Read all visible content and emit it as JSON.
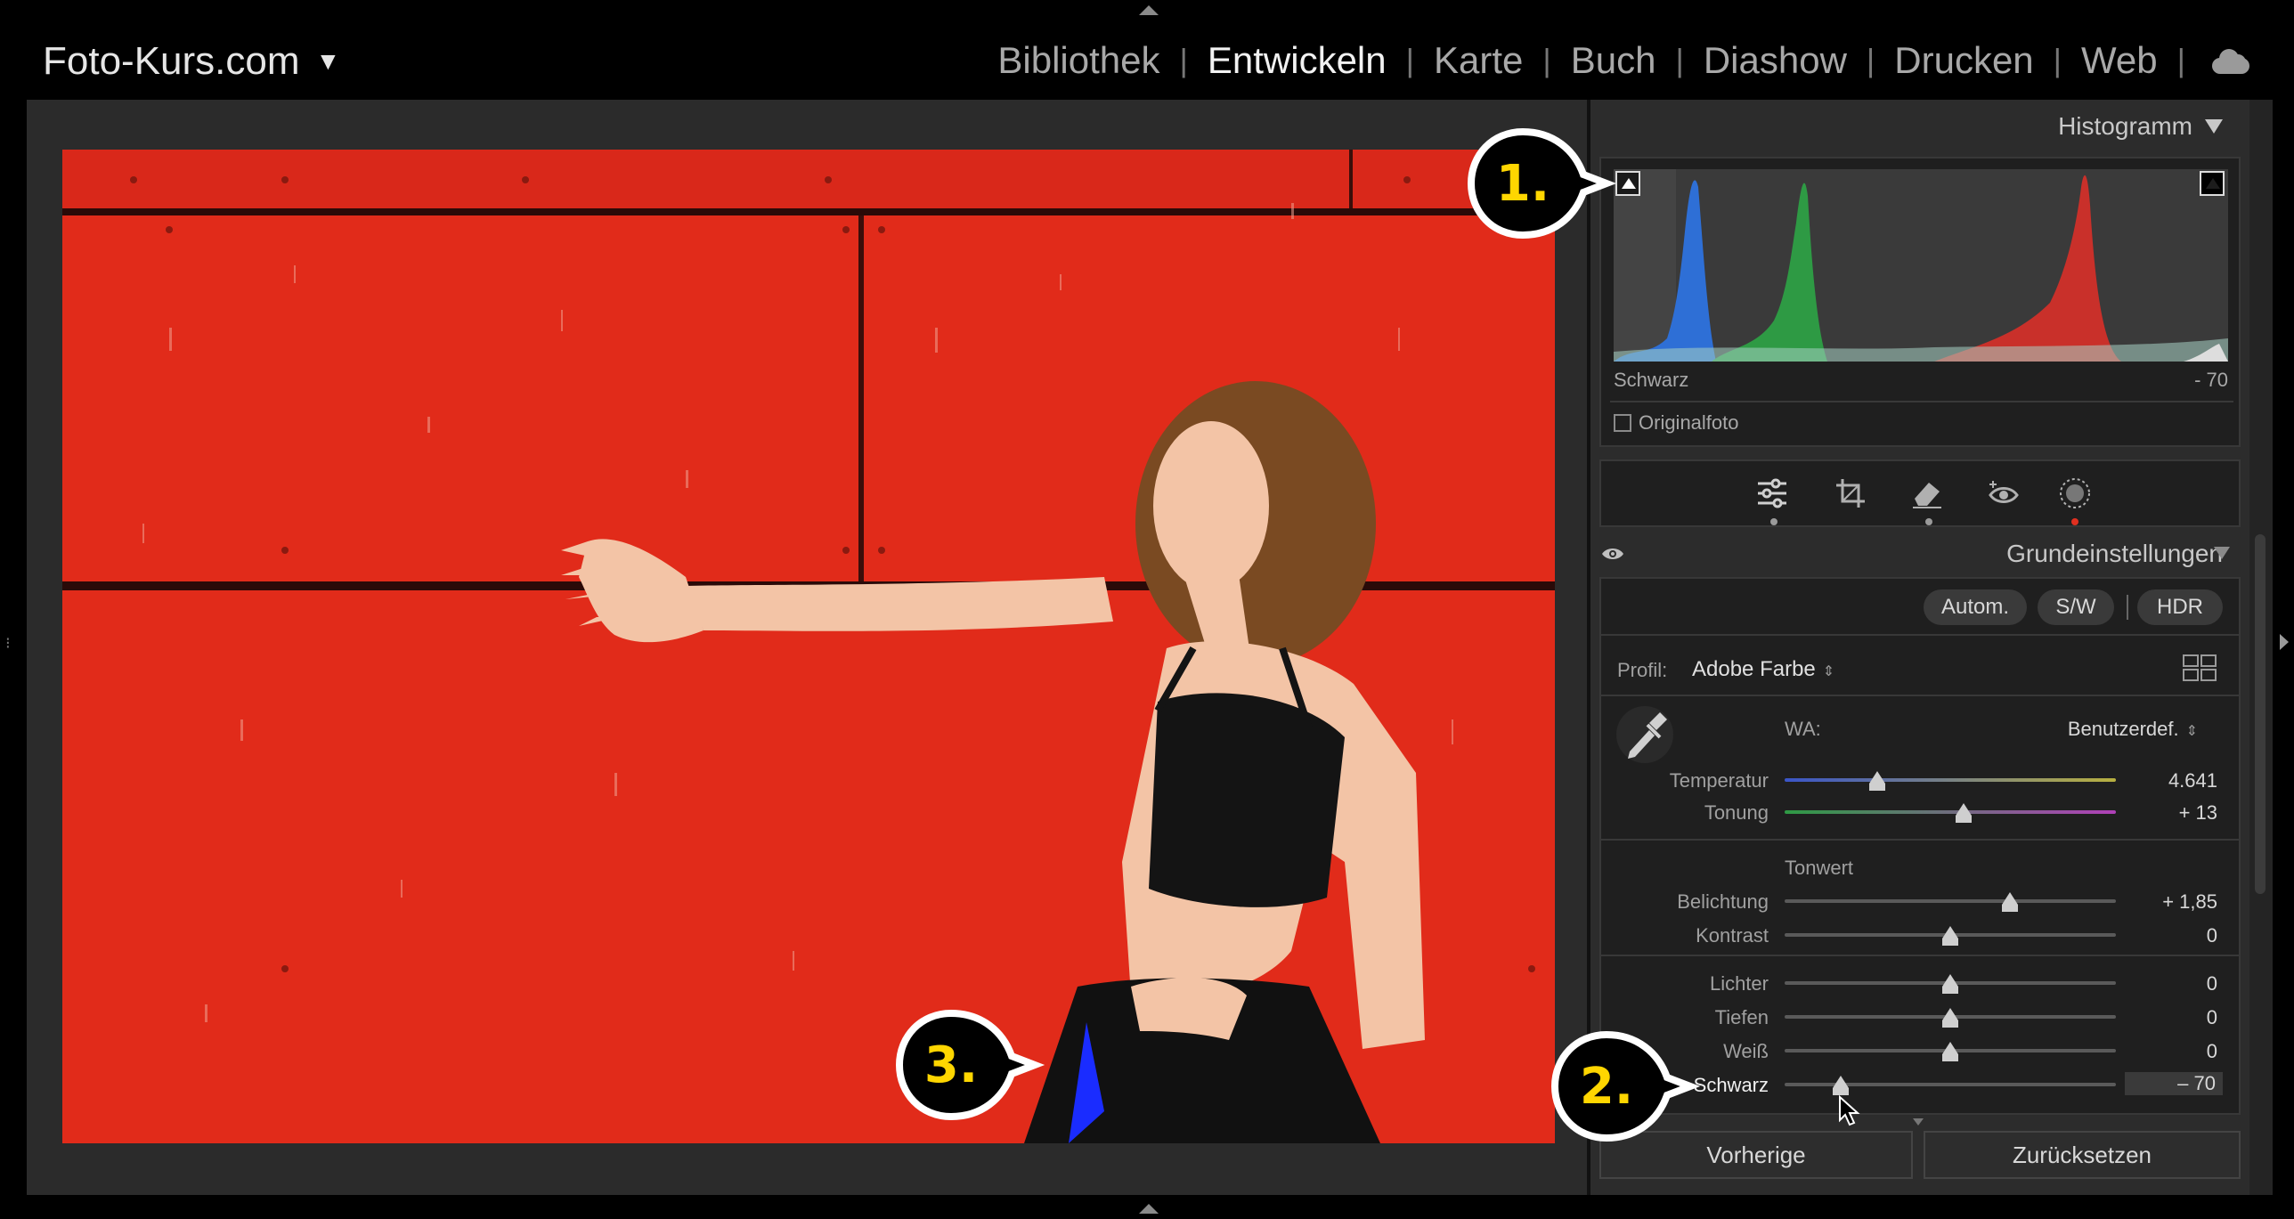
{
  "app": {
    "catalog_name": "Foto-Kurs.com",
    "modules": [
      "Bibliothek",
      "Entwickeln",
      "Karte",
      "Buch",
      "Diashow",
      "Drucken",
      "Web"
    ],
    "active_module": "Entwickeln",
    "cloud_icon": "cloud-icon"
  },
  "histogram_panel": {
    "title": "Histogramm",
    "readout_label": "Schwarz",
    "readout_value": "- 70",
    "checkbox_label": "Originalfoto",
    "shadow_clipping_on": true
  },
  "tools": {
    "icons": [
      "edit-sliders-icon",
      "crop-icon",
      "eraser-icon",
      "red-eye-icon",
      "masking-icon"
    ]
  },
  "basic_panel": {
    "title": "Grundeinstellungen",
    "auto_label": "Autom.",
    "bw_label": "S/W",
    "hdr_label": "HDR",
    "profile_label": "Profil:",
    "profile_value": "Adobe Farbe",
    "wb_label": "WA:",
    "wb_value": "Benutzerdef.",
    "tone_section": "Tonwert",
    "sliders": [
      {
        "key": "temperatur",
        "label": "Temperatur",
        "value": "4.641",
        "position": 0.28
      },
      {
        "key": "tonung",
        "label": "Tonung",
        "value": "+ 13",
        "position": 0.54
      },
      {
        "key": "belichtung",
        "label": "Belichtung",
        "value": "+ 1,85",
        "position": 0.68
      },
      {
        "key": "kontrast",
        "label": "Kontrast",
        "value": "0",
        "position": 0.5
      },
      {
        "key": "lichter",
        "label": "Lichter",
        "value": "0",
        "position": 0.5
      },
      {
        "key": "tiefen",
        "label": "Tiefen",
        "value": "0",
        "position": 0.5
      },
      {
        "key": "weiss",
        "label": "Weiß",
        "value": "0",
        "position": 0.5
      },
      {
        "key": "schwarz",
        "label": "Schwarz",
        "value": "– 70",
        "position": 0.17
      }
    ]
  },
  "footer": {
    "previous_label": "Vorherige",
    "reset_label": "Zurücksetzen"
  },
  "callouts": {
    "one": "1.",
    "two": "2.",
    "three": "3."
  },
  "colors": {
    "wall_red": "#e12b1a",
    "callout_text": "#ffd600",
    "clipping_blue": "#1a2cff"
  }
}
